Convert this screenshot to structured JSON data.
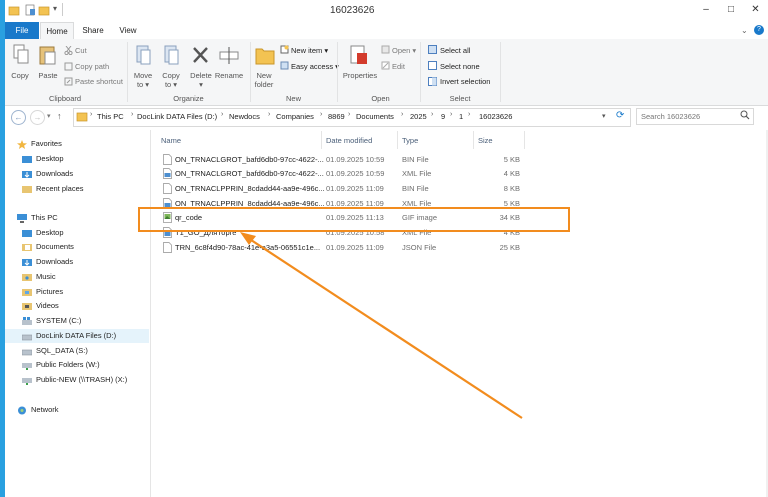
{
  "window": {
    "title": "16023626",
    "minimize": "–",
    "maximize": "□",
    "close": "✕"
  },
  "ribbon": {
    "tabs": {
      "file": "File",
      "home": "Home",
      "share": "Share",
      "view": "View"
    },
    "clipboard": {
      "copy": "Copy",
      "paste": "Paste",
      "cut": "Cut",
      "copy_path": "Copy path",
      "paste_shortcut": "Paste shortcut",
      "group": "Clipboard"
    },
    "organize": {
      "move_to": "Move to ▾",
      "copy_to": "Copy to ▾",
      "delete": "Delete ▾",
      "rename": "Rename",
      "group": "Organize"
    },
    "new": {
      "new_folder_1": "New",
      "new_folder_2": "folder",
      "new_item": "New item ▾",
      "easy_access": "Easy access ▾",
      "group": "New"
    },
    "open": {
      "properties": "Properties",
      "open": "Open ▾",
      "edit": "Edit",
      "group": "Open"
    },
    "select": {
      "select_all": "Select all",
      "select_none": "Select none",
      "invert": "Invert selection",
      "group": "Select"
    }
  },
  "address": {
    "breadcrumbs": [
      "This PC",
      "DocLink DATA Files (D:)",
      "Newdocs",
      "Companies",
      "8869",
      "Documents",
      "2025",
      "9",
      "1",
      "16023626"
    ],
    "search_placeholder": "Search 16023626"
  },
  "nav": {
    "favorites": "Favorites",
    "fav_items": [
      "Desktop",
      "Downloads",
      "Recent places"
    ],
    "this_pc": "This PC",
    "pc_items": [
      "Desktop",
      "Documents",
      "Downloads",
      "Music",
      "Pictures",
      "Videos",
      "SYSTEM (C:)",
      "DocLink DATA Files (D:)",
      "SQL_DATA (S:)",
      "Public Folders (W:)",
      "Public-NEW (\\\\TRASH) (X:)"
    ],
    "network": "Network"
  },
  "columns": {
    "name": "Name",
    "date": "Date modified",
    "type": "Type",
    "size": "Size"
  },
  "files": [
    {
      "name": "ON_TRNACLGROT_bafd6db0-97cc-4622-...",
      "date": "01.09.2025 10:59",
      "type": "BIN File",
      "size": "5 KB",
      "icon": "bin-file-icon"
    },
    {
      "name": "ON_TRNACLGROT_bafd6db0-97cc-4622-...",
      "date": "01.09.2025 10:59",
      "type": "XML File",
      "size": "4 KB",
      "icon": "xml-file-icon"
    },
    {
      "name": "ON_TRNACLPPRIN_8cdadd44-aa9e-496c...",
      "date": "01.09.2025 11:09",
      "type": "BIN File",
      "size": "8 KB",
      "icon": "bin-file-icon"
    },
    {
      "name": "ON_TRNACLPPRIN_8cdadd44-aa9e-496c...",
      "date": "01.09.2025 11:09",
      "type": "XML File",
      "size": "5 KB",
      "icon": "xml-file-icon"
    },
    {
      "name": "qr_code",
      "date": "01.09.2025 11:13",
      "type": "GIF image",
      "size": "34 KB",
      "icon": "image-file-icon"
    },
    {
      "name": "T1_GO_ДляТорге",
      "date": "01.09.2025 10:58",
      "type": "XML File",
      "size": "4 KB",
      "icon": "xml-file-icon"
    },
    {
      "name": "TRN_6c8f4d90-78ac-41e-a3a5-06551c1e...",
      "date": "01.09.2025 11:09",
      "type": "JSON File",
      "size": "25 KB",
      "icon": "json-file-icon"
    }
  ],
  "colors": {
    "accent": "#1979ca",
    "annotation": "#f28c1e",
    "frame": "#29a0e0"
  }
}
